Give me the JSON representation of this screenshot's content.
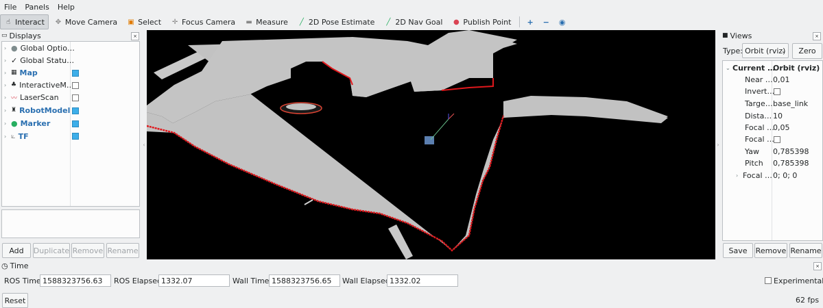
{
  "menu": [
    "File",
    "Panels",
    "Help"
  ],
  "toolbar": {
    "items": [
      {
        "label": "Interact",
        "icon": "hand-icon"
      },
      {
        "label": "Move Camera",
        "icon": "move-camera-icon"
      },
      {
        "label": "Select",
        "icon": "select-icon"
      },
      {
        "label": "Focus Camera",
        "icon": "focus-camera-icon"
      },
      {
        "label": "Measure",
        "icon": "ruler-icon"
      },
      {
        "label": "2D Pose Estimate",
        "icon": "green-arrow-icon"
      },
      {
        "label": "2D Nav Goal",
        "icon": "green-arrow-icon"
      },
      {
        "label": "Publish Point",
        "icon": "map-pin-icon"
      }
    ]
  },
  "displays": {
    "title": "Displays",
    "items": [
      {
        "label": "Global Optio…",
        "bold": false
      },
      {
        "label": "Global Statu…",
        "bold": false
      },
      {
        "label": "Map",
        "bold": true,
        "checked": true
      },
      {
        "label": "InteractiveM…",
        "bold": false,
        "checked": false
      },
      {
        "label": "LaserScan",
        "bold": false,
        "checked": false
      },
      {
        "label": "RobotModel",
        "bold": true,
        "checked": true
      },
      {
        "label": "Marker",
        "bold": true,
        "checked": true
      },
      {
        "label": "TF",
        "bold": true,
        "checked": true
      }
    ],
    "buttons": {
      "add": "Add",
      "duplicate": "Duplicate",
      "remove": "Remove",
      "rename": "Rename"
    }
  },
  "views": {
    "title": "Views",
    "type_label": "Type:",
    "type_value": "Orbit (rviz)",
    "zero": "Zero",
    "header_name": "Current …",
    "header_value": "Orbit (rviz)",
    "props": [
      {
        "name": "Near …",
        "value": "0,01"
      },
      {
        "name": "Invert…",
        "value": ""
      },
      {
        "name": "Targe…",
        "value": "base_link"
      },
      {
        "name": "Dista…",
        "value": "10"
      },
      {
        "name": "Focal …",
        "value": "0,05"
      },
      {
        "name": "Focal …",
        "value": ""
      },
      {
        "name": "Yaw",
        "value": "0,785398"
      },
      {
        "name": "Pitch",
        "value": "0,785398"
      },
      {
        "name": "Focal …",
        "value": "0; 0; 0"
      }
    ],
    "buttons": {
      "save": "Save",
      "remove": "Remove",
      "rename": "Rename"
    }
  },
  "time": {
    "title": "Time",
    "ros_time_label": "ROS Time:",
    "ros_time": "1588323756.63",
    "ros_elapsed_label": "ROS Elapsed:",
    "ros_elapsed": "1332.07",
    "wall_time_label": "Wall Time:",
    "wall_time": "1588323756.65",
    "wall_elapsed_label": "Wall Elapsed:",
    "wall_elapsed": "1332.02",
    "experimental": "Experimental"
  },
  "status": {
    "reset": "Reset",
    "fps": "62 fps"
  }
}
